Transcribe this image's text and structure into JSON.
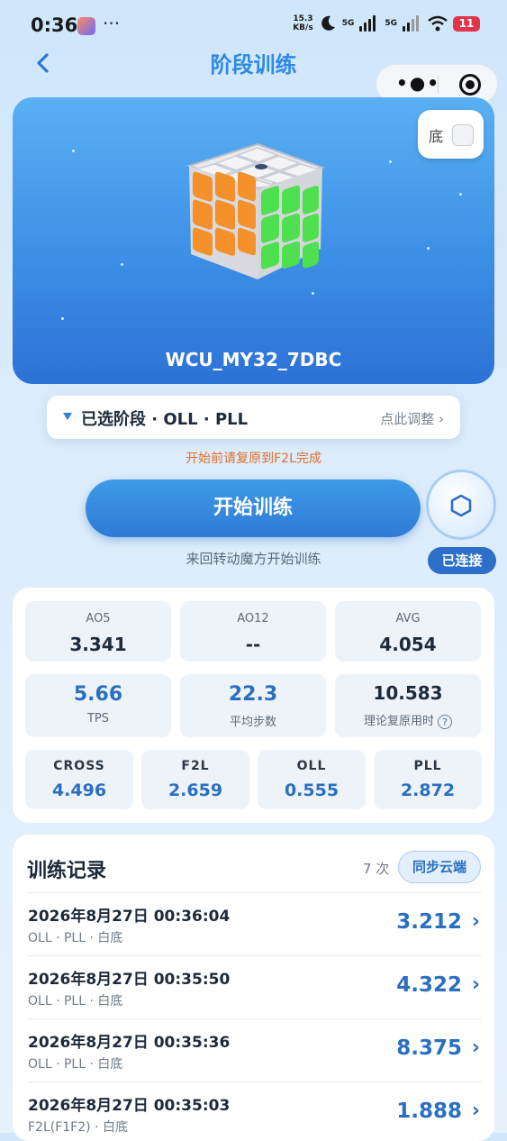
{
  "status_bar": {
    "time": "0:36",
    "more": "···",
    "net_speed_value": "15.3",
    "net_speed_unit": "KB/s",
    "sim1": "5G",
    "sim2": "5G",
    "battery": "11"
  },
  "header": {
    "title": "阶段训练"
  },
  "cube_card": {
    "device_name": "WCU_MY32_7DBC",
    "bottom_toggle_label": "底"
  },
  "stage_selector": {
    "label": "已选阶段 · OLL · PLL",
    "adjust": "点此调整 ›"
  },
  "hint_text": "开始前请复原到F2L完成",
  "start_button": "开始训练",
  "sub_hint": "来回转动魔方开始训练",
  "connection_status": "已连接",
  "stats": {
    "ao5_label": "AO5",
    "ao5_value": "3.341",
    "ao12_label": "AO12",
    "ao12_value": "--",
    "avg_label": "AVG",
    "avg_value": "4.054",
    "tps_value": "5.66",
    "tps_label": "TPS",
    "steps_value": "22.3",
    "steps_label": "平均步数",
    "theory_value": "10.583",
    "theory_label": "理论复原用时",
    "help": "?",
    "cross_label": "CROSS",
    "cross_value": "4.496",
    "f2l_label": "F2L",
    "f2l_value": "2.659",
    "oll_label": "OLL",
    "oll_value": "0.555",
    "pll_label": "PLL",
    "pll_value": "2.872"
  },
  "records": {
    "title": "训练记录",
    "count": "7 次",
    "sync_button": "同步云端",
    "items": [
      {
        "date": "2026年8月27日 00:36:04",
        "meta": "OLL · PLL · 白底",
        "time": "3.212"
      },
      {
        "date": "2026年8月27日 00:35:50",
        "meta": "OLL · PLL · 白底",
        "time": "4.322"
      },
      {
        "date": "2026年8月27日 00:35:36",
        "meta": "OLL · PLL · 白底",
        "time": "8.375"
      },
      {
        "date": "2026年8月27日 00:35:03",
        "meta": "F2L(F1F2) · 白底",
        "time": "1.888"
      }
    ],
    "chevron": "›"
  },
  "colors": {
    "accent": "#2e8ae6",
    "card_blue": "#3d8fe6",
    "hint_orange": "#e0712b",
    "cube_orange": "#f5912a",
    "cube_green": "#4ee04e",
    "cube_white": "#f1f1f3"
  }
}
